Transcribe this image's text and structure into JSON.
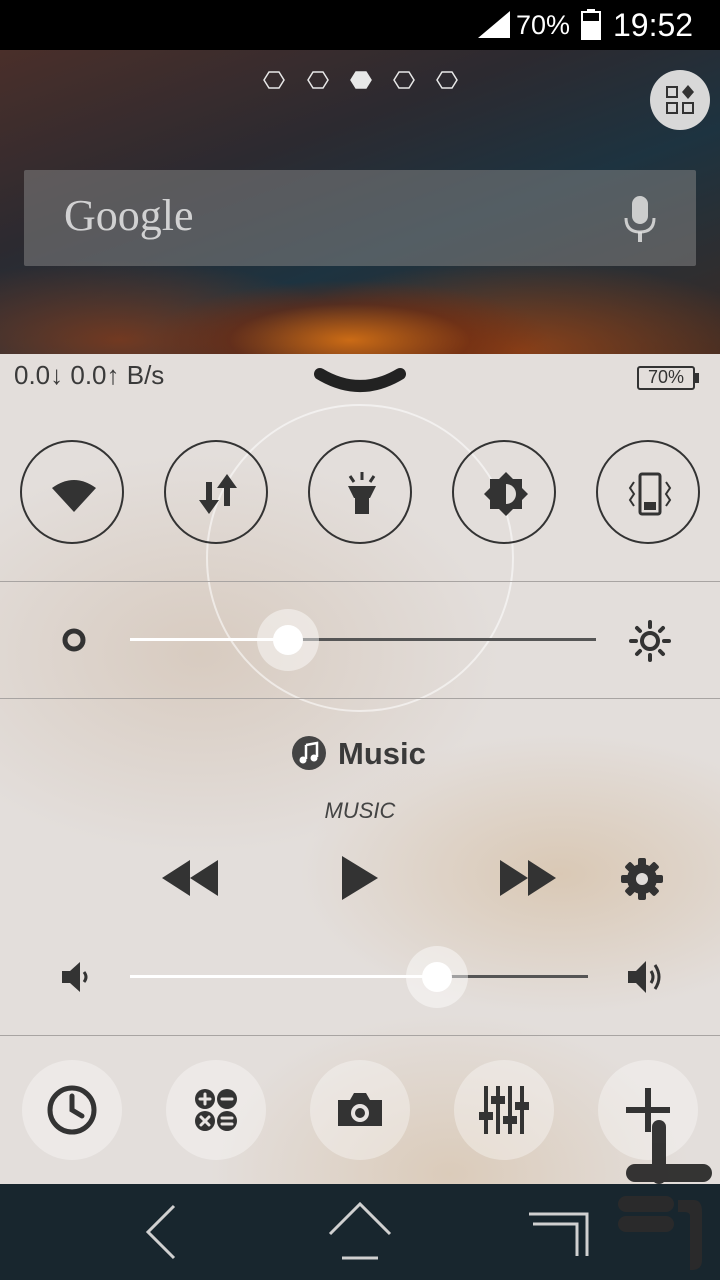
{
  "status_bar": {
    "battery_percent": "70%",
    "time": "19:52"
  },
  "home": {
    "page_indicator": {
      "count": 5,
      "active_index": 2
    },
    "search": {
      "logo_text": "Google"
    }
  },
  "panel": {
    "net_speed": "0.0↓ 0.0↑ B/s",
    "battery_badge": "70%",
    "toggles": [
      {
        "name": "wifi",
        "icon": "wifi-icon"
      },
      {
        "name": "mobile-data",
        "icon": "data-transfer-icon"
      },
      {
        "name": "flashlight",
        "icon": "flashlight-icon"
      },
      {
        "name": "auto-brightness",
        "icon": "brightness-auto-icon"
      },
      {
        "name": "vibrate",
        "icon": "vibrate-icon"
      }
    ],
    "brightness": {
      "level": 0.34
    },
    "music": {
      "title": "Music",
      "subtitle": "MUSIC"
    },
    "volume": {
      "level": 0.67
    },
    "dock": [
      {
        "name": "clock",
        "icon": "clock-icon"
      },
      {
        "name": "calculator",
        "icon": "calculator-icon"
      },
      {
        "name": "camera",
        "icon": "camera-icon"
      },
      {
        "name": "equalizer",
        "icon": "equalizer-icon"
      },
      {
        "name": "add",
        "icon": "plus-icon"
      }
    ]
  },
  "nav": {
    "buttons": [
      "back",
      "home",
      "recents"
    ]
  }
}
